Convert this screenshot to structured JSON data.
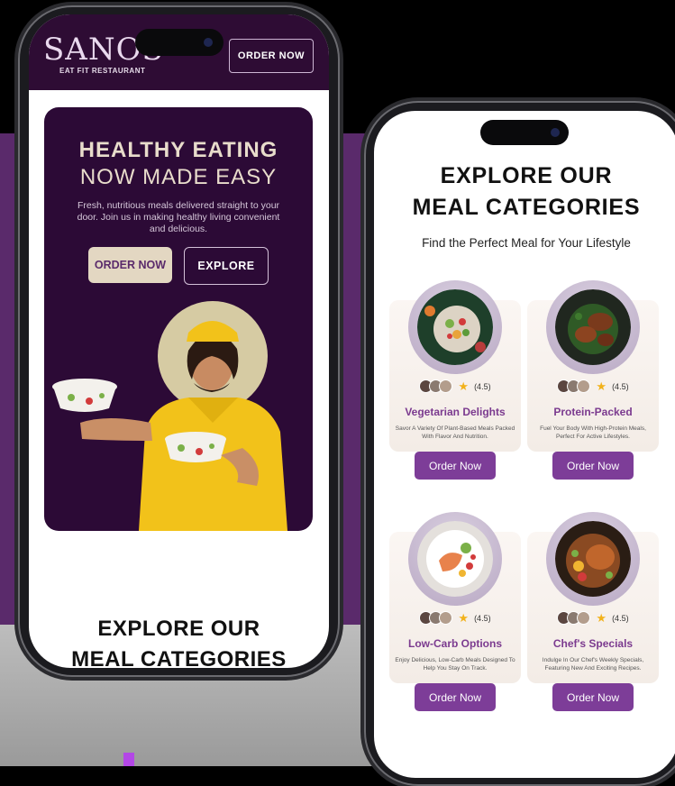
{
  "left_phone": {
    "header": {
      "logo": "SANOS",
      "logo_sub": "EAT FIT RESTAURANT",
      "order_button": "ORDER NOW"
    },
    "hero": {
      "title_line1": "HEALTHY EATING",
      "title_line2": "NOW MADE EASY",
      "description": "Fresh, nutritious meals delivered straight to your door. Join us in making healthy living convenient and delicious.",
      "order_button": "ORDER NOW",
      "explore_button": "EXPLORE"
    },
    "section_title_line1": "EXPLORE OUR",
    "section_title_line2": "MEAL CATEGORIES"
  },
  "right_phone": {
    "title_line1": "EXPLORE OUR",
    "title_line2": "MEAL CATEGORIES",
    "subtitle": "Find the Perfect Meal for Your Lifestyle",
    "cards": [
      {
        "rating": "(4.5)",
        "title": "Vegetarian Delights",
        "description": "Savor A Variety Of Plant-Based Meals Packed With Flavor And Nutrition.",
        "button": "Order Now",
        "dish_icon": "vegetable-bowl-icon"
      },
      {
        "rating": "(4.5)",
        "title": "Protein-Packed",
        "description": "Fuel Your Body With High-Protein Meals, Perfect For Active Lifestyles.",
        "button": "Order Now",
        "dish_icon": "chicken-plate-icon"
      },
      {
        "rating": "(4.5)",
        "title": "Low-Carb Options",
        "description": "Enjoy Delicious, Low-Carb Meals Designed To Help You Stay On Track.",
        "button": "Order Now",
        "dish_icon": "salmon-plate-icon"
      },
      {
        "rating": "(4.5)",
        "title": "Chef's Specials",
        "description": "Indulge In Our Chef's Weekly Specials, Featuring New And Exciting Recipes.",
        "button": "Order Now",
        "dish_icon": "roast-chicken-icon"
      }
    ]
  },
  "colors": {
    "brand_purple": "#2e0c34",
    "accent_purple": "#7d3d98",
    "cream": "#e3d7c2",
    "star": "#f2b21c",
    "background_band": "#5a2a6b"
  }
}
